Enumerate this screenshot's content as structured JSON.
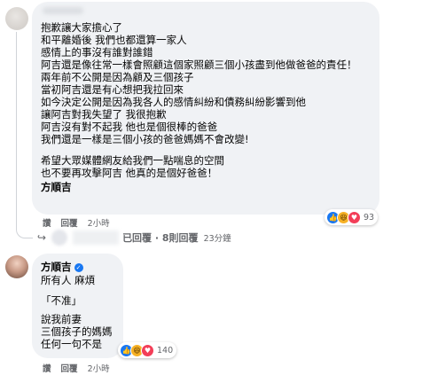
{
  "comment1": {
    "avatar_icon": "avatar-blurred",
    "lines": [
      "抱歉讓大家擔心了",
      "和平離婚後 我們也都還算一家人",
      "感情上的事沒有誰對誰錯",
      "阿吉還是像往常一樣會照顧這個家照顧三個小孩盡到他做爸爸的責任！",
      "兩年前不公開是因為顧及三個孩子",
      "當初阿吉還是有心想把我拉回來",
      "如今決定公開是因為我各人的感情糾紛和債務糾紛影響到他",
      "讓阿吉對我失望了 我很抱歉",
      "阿吉沒有對不起我 他也是個很棒的爸爸",
      "我們還是一樣是三個小孩的爸爸媽媽不會改變!",
      "",
      "希望大眾媒體網友給我們一點喘息的空間",
      "也不要再攻擊阿吉 他真的是個好爸爸！",
      "方順吉"
    ],
    "actions": {
      "like": "讚",
      "reply": "回覆",
      "time": "2小時"
    },
    "reactions": {
      "icons": [
        "like-icon",
        "haha-icon",
        "love-icon"
      ],
      "count": "93"
    },
    "replies": {
      "text": "已回覆 · 8則回覆",
      "time": "23分鐘"
    }
  },
  "comment2": {
    "author": "方順吉",
    "verified_icon": "verified-badge-icon",
    "lines": [
      "所有人 麻煩",
      "",
      "「不准」",
      "",
      "說我前妻",
      "三個孩子的媽媽",
      "任何一句不是"
    ],
    "actions": {
      "like": "讚",
      "reply": "回覆",
      "time": "2小時"
    },
    "reactions": {
      "icons": [
        "like-icon",
        "haha-icon",
        "love-icon"
      ],
      "count": "140"
    }
  }
}
